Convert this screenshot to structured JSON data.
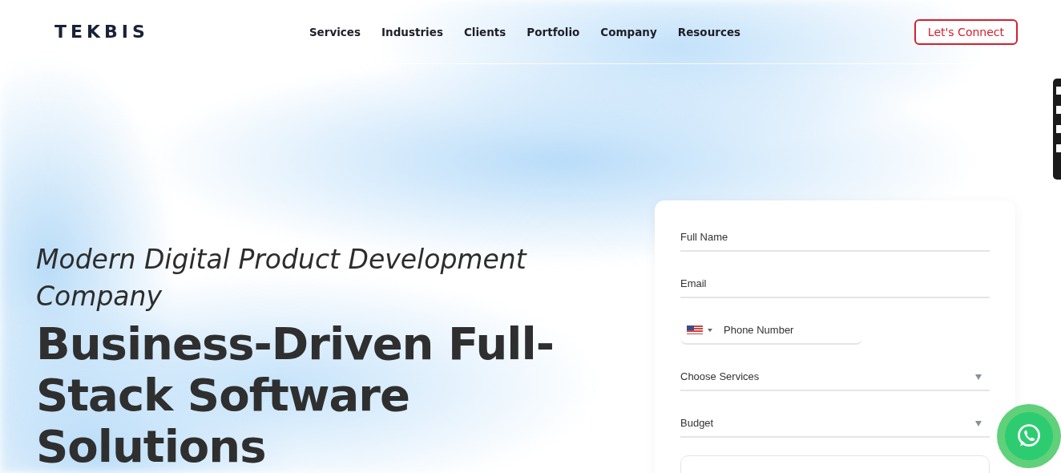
{
  "header": {
    "logo": "TEKBIS",
    "nav": [
      {
        "label": "Services"
      },
      {
        "label": "Industries"
      },
      {
        "label": "Clients"
      },
      {
        "label": "Portfolio"
      },
      {
        "label": "Company"
      },
      {
        "label": "Resources"
      }
    ],
    "cta": "Let's Connect"
  },
  "hero": {
    "subtitle": "Modern Digital Product Development Company",
    "title": "Business-Driven Full-Stack Software Solutions"
  },
  "form": {
    "fields": [
      {
        "kind": "text",
        "placeholder": "Full Name"
      },
      {
        "kind": "text",
        "placeholder": "Email"
      },
      {
        "kind": "phone",
        "placeholder": "Phone Number"
      },
      {
        "kind": "select",
        "placeholder": "Choose Services"
      },
      {
        "kind": "select",
        "placeholder": "Budget"
      },
      {
        "kind": "textarea"
      }
    ]
  }
}
